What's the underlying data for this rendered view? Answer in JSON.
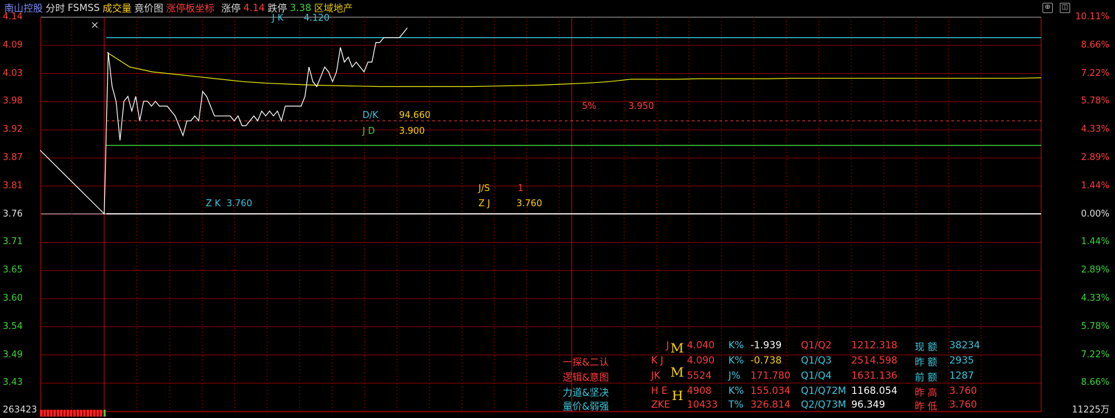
{
  "topbar": {
    "stock": "南山控股",
    "tab_time": "分时",
    "tab_fsmss": "FSMSS",
    "tab_volume": "成交量",
    "tab_auction": "竟价图",
    "tab_limit": "涨停板坐标",
    "limit_up_label": "涨停",
    "limit_up_value": "4.14",
    "limit_down_label": "跌停",
    "limit_down_value": "3.38",
    "sector": "区域地产"
  },
  "colors": {
    "up": "#ff3c3c",
    "down": "#3cd23c",
    "grid": "#8b0000",
    "price_line": "#ffffff",
    "avg_line": "#e6e600",
    "cyan": "#3cc8dc",
    "yellow": "#ffd400"
  },
  "axes": {
    "left_prices": [
      "4.14",
      "4.09",
      "4.03",
      "3.98",
      "3.92",
      "3.87",
      "3.81",
      "3.76",
      "3.71",
      "3.65",
      "3.60",
      "3.54",
      "3.49",
      "3.43"
    ],
    "right_percents": [
      "10.11%",
      "8.66%",
      "7.22%",
      "5.78%",
      "4.33%",
      "2.89%",
      "1.44%",
      "0.00%",
      "1.44%",
      "2.89%",
      "4.33%",
      "5.78%",
      "7.22%",
      "8.66%"
    ],
    "volume_left": "263423",
    "volume_right": "11225万"
  },
  "annotations": {
    "jk_label": "J K",
    "jk_value": "4.120",
    "dk_label": "D/K",
    "dk_value": "94.660",
    "jd_label": "J D",
    "jd_value": "3.900",
    "five_pct_label": "5%",
    "five_pct_value": "3.950",
    "js_label": "J/S",
    "js_value": "1",
    "zj_label": "Z J",
    "zj_value": "3.760",
    "zk_label": "Z K",
    "zk_value": "3.760",
    "close_mark": "×"
  },
  "chart_data": {
    "type": "line",
    "price_series": [
      3.76,
      4.09,
      4.02,
      3.99,
      3.91,
      3.99,
      4.0,
      3.97,
      4.0,
      3.95,
      3.99,
      3.99,
      3.98,
      3.99,
      3.98,
      3.98,
      3.98,
      3.97,
      3.96,
      3.94,
      3.92,
      3.95,
      3.95,
      3.96,
      3.95,
      4.01,
      4.0,
      3.98,
      3.96,
      3.96,
      3.96,
      3.96,
      3.96,
      3.95,
      3.96,
      3.94,
      3.94,
      3.95,
      3.96,
      3.95,
      3.97,
      3.96,
      3.97,
      3.96,
      3.97,
      3.95,
      3.98,
      3.98,
      3.98,
      3.98,
      3.98,
      4.0,
      4.06,
      4.03,
      4.02,
      4.04,
      4.06,
      4.05,
      4.03,
      4.05,
      4.1,
      4.07,
      4.08,
      4.06,
      4.07,
      4.06,
      4.05,
      4.07,
      4.07,
      4.11,
      4.11,
      4.12,
      4.12,
      4.12,
      4.12,
      4.12,
      4.13,
      4.14
    ],
    "avg_series": [
      4.09,
      4.06,
      4.05,
      4.045,
      4.04,
      4.035,
      4.03,
      4.027,
      4.025,
      4.023,
      4.022,
      4.021,
      4.02,
      4.02,
      4.02,
      4.02,
      4.02,
      4.021,
      4.022,
      4.023,
      4.025,
      4.027,
      4.03,
      4.035,
      4.035,
      4.035,
      4.036,
      4.036,
      4.036,
      4.036,
      4.037,
      4.037,
      4.037,
      4.037,
      4.037,
      4.037,
      4.037,
      4.037,
      4.037,
      4.037,
      4.037,
      4.038
    ],
    "levels": {
      "jk": 4.12,
      "jd": 3.9,
      "five_pct": 3.95,
      "zk": 3.76
    },
    "ylim": [
      3.38,
      4.14
    ]
  },
  "table": {
    "rows": [
      {
        "c1": "",
        "c2": "J",
        "c3": "4.040",
        "c4": "K%",
        "c5": "-1.939",
        "c6": "Q1/Q2",
        "c7": "1212.318",
        "c8": "现 额",
        "c9": "38234"
      },
      {
        "c1": "一探&二认",
        "c2": "K J",
        "c3": "4.090",
        "c4": "K%",
        "c5": "-0.738",
        "c6": "Q1/Q3",
        "c7": "2514.598",
        "c8": "昨 额",
        "c9": "2935"
      },
      {
        "c1": "逻辑&意图",
        "c2": "JK",
        "c3": "5524",
        "c4": "J%",
        "c5": "171.780",
        "c6": "Q1/Q4",
        "c7": "1631.136",
        "c8": "前 额",
        "c9": "1287"
      },
      {
        "c1": "力道&坚决",
        "c2": "H E",
        "c3": "4908",
        "c4": "K%",
        "c5": "155.034",
        "c6": "Q1/Q72M",
        "c7": "1168.054",
        "c8": "昨 高",
        "c9": "3.760"
      },
      {
        "c1": "量价&弱强",
        "c2": "ZKE",
        "c3": "10433",
        "c4": "T%",
        "c5": "326.814",
        "c6": "Q2/Q73M",
        "c7": "96.349",
        "c8": "昨 低",
        "c9": "3.760"
      }
    ],
    "marks": [
      "M",
      "M",
      "H"
    ]
  }
}
